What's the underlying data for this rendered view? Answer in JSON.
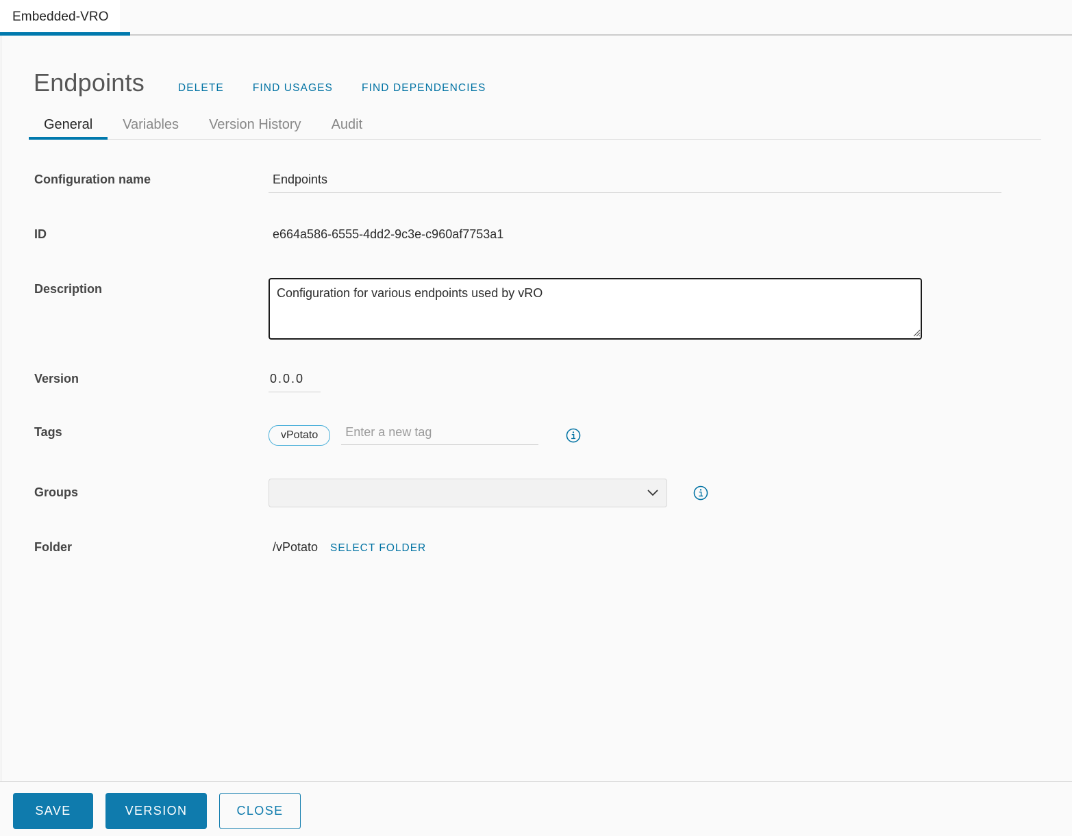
{
  "app_tabs": [
    {
      "label": "Embedded-VRO",
      "active": true
    }
  ],
  "header": {
    "title": "Endpoints",
    "actions": [
      {
        "label": "DELETE",
        "name": "delete"
      },
      {
        "label": "FIND USAGES",
        "name": "find-usages"
      },
      {
        "label": "FIND DEPENDENCIES",
        "name": "find-dependencies"
      }
    ]
  },
  "tabs": [
    {
      "label": "General",
      "active": true
    },
    {
      "label": "Variables",
      "active": false
    },
    {
      "label": "Version History",
      "active": false
    },
    {
      "label": "Audit",
      "active": false
    }
  ],
  "form": {
    "configuration_name": {
      "label": "Configuration name",
      "value": "Endpoints",
      "placeholder": ""
    },
    "id": {
      "label": "ID",
      "value": "e664a586-6555-4dd2-9c3e-c960af7753a1"
    },
    "description": {
      "label": "Description",
      "value": "Configuration for various endpoints used by vRO",
      "placeholder": ""
    },
    "version": {
      "label": "Version",
      "value": "0.0.0",
      "placeholder": ""
    },
    "tags": {
      "label": "Tags",
      "pills": [
        "vPotato"
      ],
      "input_value": "",
      "placeholder": "Enter a new tag",
      "info_icon": "info-circle-icon"
    },
    "groups": {
      "label": "Groups",
      "selected": "",
      "options": [
        ""
      ],
      "info_icon": "info-circle-icon",
      "chevron_icon": "chevron-down-icon"
    },
    "folder": {
      "label": "Folder",
      "path": "/vPotato",
      "select_label": "SELECT FOLDER"
    }
  },
  "footer": {
    "buttons": [
      {
        "label": "SAVE",
        "name": "save",
        "style": "primary"
      },
      {
        "label": "VERSION",
        "name": "version",
        "style": "primary"
      },
      {
        "label": "CLOSE",
        "name": "close",
        "style": "outline"
      }
    ]
  },
  "colors": {
    "accent": "#0079ad",
    "link": "#0072a3",
    "button": "#0f7bad",
    "tag_border": "#49afd9",
    "background": "#fafafa"
  }
}
